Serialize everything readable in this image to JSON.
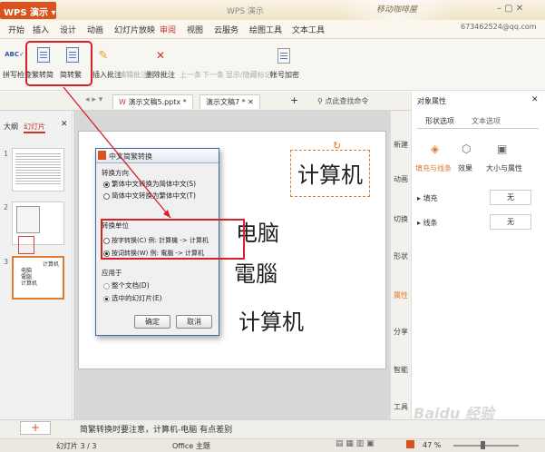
{
  "app": {
    "name": "WPS 演示",
    "window_title": "WPS 演示",
    "decor_text": "移动咖啡屋",
    "account": "673462524@qq.com"
  },
  "menu": [
    "开始",
    "插入",
    "设计",
    "动画",
    "幻灯片放映",
    "审阅",
    "视图",
    "云服务",
    "绘图工具",
    "文本工具"
  ],
  "active_menu": "审阅",
  "ribbon": {
    "spell_check": "拼写检查",
    "trad_to_simp": "繁转简",
    "simp_to_trad": "简转繁",
    "insert_comment": "插入批注",
    "edit_comment": "编辑批注",
    "delete_comment": "删除批注",
    "prev": "上一条",
    "next": "下一条",
    "show_hide_markup": "显示/隐藏标记",
    "account_encrypt": "帐号加密"
  },
  "tabs": [
    "演示文稿5.pptx *",
    "演示文稿7 *"
  ],
  "search": {
    "placeholder": "点此查找命令"
  },
  "left_panel": {
    "outline_tab": "大纲",
    "slides_tab": "幻灯片",
    "slide_nums": [
      "1",
      "2",
      "3"
    ],
    "thumb3_text": [
      "计算机",
      "电脑",
      "電腦",
      "计算机"
    ]
  },
  "dialog": {
    "title": "中文简繁转换",
    "direction_label": "转换方向",
    "opt_trad_to_simp": "繁体中文转换为简体中文(S)",
    "opt_simp_to_trad": "简体中文转换为繁体中文(T)",
    "unit_label": "转换单位",
    "opt_by_char": "按字转换(C) 例: 計算機 -> 计算机",
    "opt_by_word": "按词转换(W) 例: 電腦 -> 计算机",
    "apply_label": "应用于",
    "opt_all_docs": "整个文档(D)",
    "opt_selected_slides": "选中的幻灯片(E)",
    "ok": "确定",
    "cancel": "取消"
  },
  "slide": {
    "title_text": "计算机",
    "line1": "电脑",
    "line2": "電腦",
    "line3": "计算机"
  },
  "right_strip": [
    "新建",
    "动画",
    "切换",
    "形状",
    "属性",
    "分享",
    "智能",
    "工具"
  ],
  "properties": {
    "header": "对象属性",
    "tab_shape": "形状选项",
    "tab_text": "文本选项",
    "sub_fill": "填充与线条",
    "sub_effect": "效果",
    "sub_size": "大小与属性",
    "fill_label": "填充",
    "fill_value": "无",
    "line_label": "线条",
    "line_value": "无"
  },
  "notes": "简繁转换时要注意，计算机-电脑 有点差别",
  "status": {
    "slide_count": "幻灯片 3 / 3",
    "theme": "Office 主题",
    "zoom": "47 %"
  },
  "watermark": "Baidu 经验",
  "colors": {
    "accent": "#d9531e",
    "annotation": "#d8202a",
    "active_tab": "#c0392b"
  }
}
